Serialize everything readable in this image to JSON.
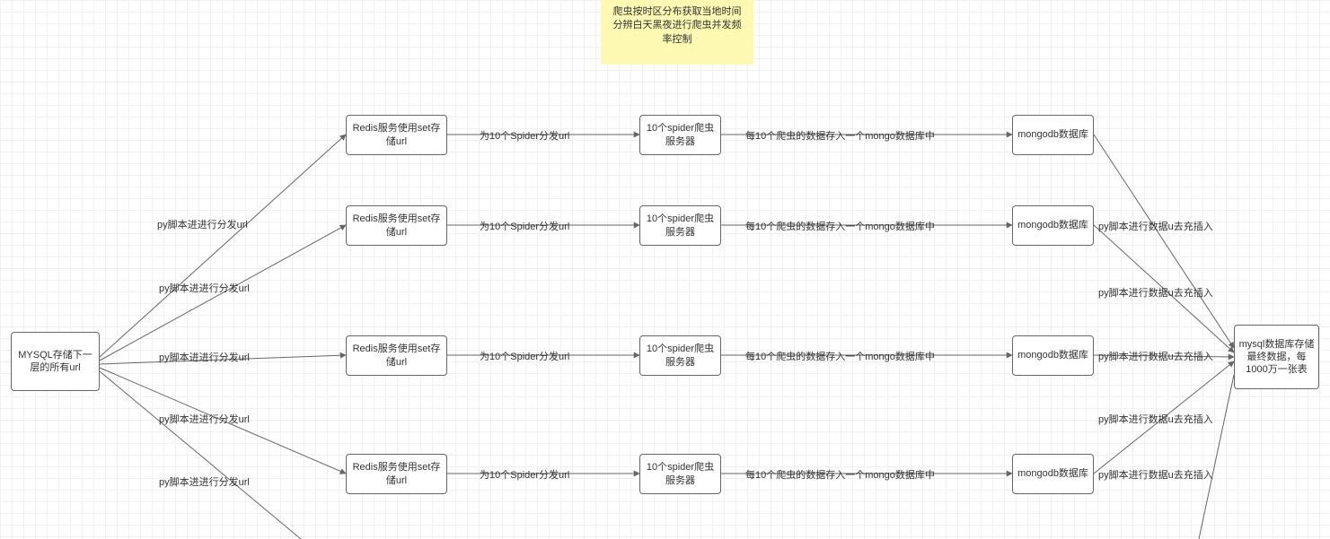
{
  "note": {
    "text": "爬虫按时区分布获取当地时间分辨白天黑夜进行爬虫并发频率控制"
  },
  "nodes": {
    "source": "MYSQL存储下一层的所有url",
    "redis": "Redis服务使用set存储url",
    "spider": "10个spider爬虫服务器",
    "mongo": "mongodb数据库",
    "sink": "mysql数据库存储最终数据，每1000万一张表"
  },
  "edge_labels": {
    "a": "py脚本进进行分发url",
    "b": "为10个Spider分发url",
    "c": "每10个爬虫的数据存入一个mongo数据库中",
    "d": "py脚本进行数据u去充插入"
  },
  "chart_data": {
    "type": "diagram",
    "title": "",
    "note": "爬虫按时区分布获取当地时间分辨白天黑夜进行爬虫并发频率控制",
    "nodes": [
      {
        "id": "mysql_src",
        "label": "MYSQL存储下一层的所有url"
      },
      {
        "id": "redis1",
        "label": "Redis服务使用set存储url"
      },
      {
        "id": "redis2",
        "label": "Redis服务使用set存储url"
      },
      {
        "id": "redis3",
        "label": "Redis服务使用set存储url"
      },
      {
        "id": "redis4",
        "label": "Redis服务使用set存储url"
      },
      {
        "id": "spider1",
        "label": "10个spider爬虫服务器"
      },
      {
        "id": "spider2",
        "label": "10个spider爬虫服务器"
      },
      {
        "id": "spider3",
        "label": "10个spider爬虫服务器"
      },
      {
        "id": "spider4",
        "label": "10个spider爬虫服务器"
      },
      {
        "id": "mongo1",
        "label": "mongodb数据库"
      },
      {
        "id": "mongo2",
        "label": "mongodb数据库"
      },
      {
        "id": "mongo3",
        "label": "mongodb数据库"
      },
      {
        "id": "mongo4",
        "label": "mongodb数据库"
      },
      {
        "id": "mysql_sink",
        "label": "mysql数据库存储最终数据，每1000万一张表"
      }
    ],
    "edges": [
      {
        "from": "mysql_src",
        "to": "redis1",
        "label": "py脚本进进行分发url"
      },
      {
        "from": "mysql_src",
        "to": "redis2",
        "label": "py脚本进进行分发url"
      },
      {
        "from": "mysql_src",
        "to": "redis3",
        "label": "py脚本进进行分发url"
      },
      {
        "from": "mysql_src",
        "to": "redis4",
        "label": "py脚本进进行分发url"
      },
      {
        "from": "mysql_src",
        "to": "redis_offscreen",
        "label": "py脚本进进行分发url"
      },
      {
        "from": "redis1",
        "to": "spider1",
        "label": "为10个Spider分发url"
      },
      {
        "from": "redis2",
        "to": "spider2",
        "label": "为10个Spider分发url"
      },
      {
        "from": "redis3",
        "to": "spider3",
        "label": "为10个Spider分发url"
      },
      {
        "from": "redis4",
        "to": "spider4",
        "label": "为10个Spider分发url"
      },
      {
        "from": "spider1",
        "to": "mongo1",
        "label": "每10个爬虫的数据存入一个mongo数据库中"
      },
      {
        "from": "spider2",
        "to": "mongo2",
        "label": "每10个爬虫的数据存入一个mongo数据库中"
      },
      {
        "from": "spider3",
        "to": "mongo3",
        "label": "每10个爬虫的数据存入一个mongo数据库中"
      },
      {
        "from": "spider4",
        "to": "mongo4",
        "label": "每10个爬虫的数据存入一个mongo数据库中"
      },
      {
        "from": "mongo1",
        "to": "mysql_sink",
        "label": "py脚本进行数据u去充插入"
      },
      {
        "from": "mongo2",
        "to": "mysql_sink",
        "label": "py脚本进行数据u去充插入"
      },
      {
        "from": "mongo3",
        "to": "mysql_sink",
        "label": "py脚本进行数据u去充插入"
      },
      {
        "from": "mongo4",
        "to": "mysql_sink",
        "label": "py脚本进行数据u去充插入"
      },
      {
        "from": "mongo_offscreen",
        "to": "mysql_sink",
        "label": "py脚本进行数据u去充插入"
      }
    ]
  }
}
